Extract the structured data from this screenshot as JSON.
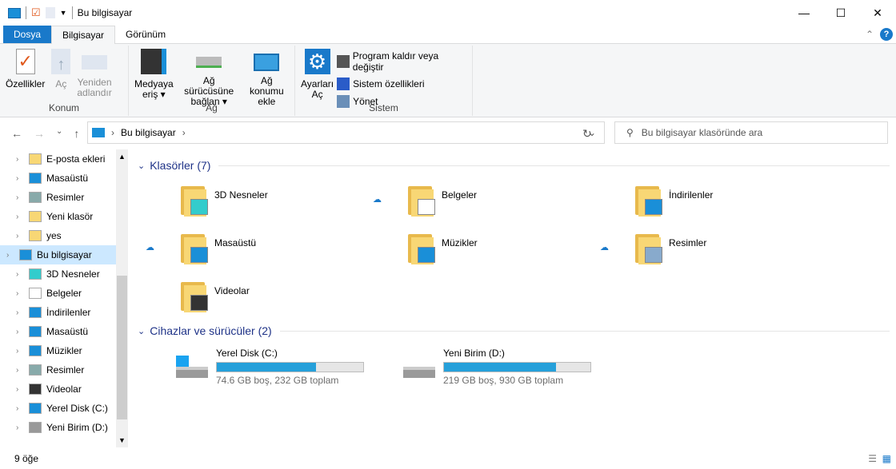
{
  "title": "Bu bilgisayar",
  "tabs": {
    "file": "Dosya",
    "computer": "Bilgisayar",
    "view": "Görünüm"
  },
  "ribbon": {
    "konum": {
      "label": "Konum",
      "properties": "Özellikler",
      "open": "Aç",
      "rename1": "Yeniden",
      "rename2": "adlandır"
    },
    "ag": {
      "label": "Ağ",
      "media1": "Medyaya",
      "media2": "eriş",
      "map1": "Ağ sürücüsüne",
      "map2": "bağlan",
      "addloc1": "Ağ konumu",
      "addloc2": "ekle"
    },
    "sistem": {
      "label": "Sistem",
      "settings1": "Ayarları",
      "settings2": "Aç",
      "uninstall": "Program kaldır veya değiştir",
      "sysprops": "Sistem özellikleri",
      "manage": "Yönet"
    }
  },
  "address": {
    "path": "Bu bilgisayar",
    "search_placeholder": "Bu bilgisayar klasöründe ara"
  },
  "sidebar": {
    "items": [
      "E-posta ekleri",
      "Masaüstü",
      "Resimler",
      "Yeni klasör",
      "yes",
      "Bu bilgisayar",
      "3D Nesneler",
      "Belgeler",
      "İndirilenler",
      "Masaüstü",
      "Müzikler",
      "Resimler",
      "Videolar",
      "Yerel Disk (C:)",
      "Yeni Birim (D:)"
    ]
  },
  "folders": {
    "header": "Klasörler (7)",
    "items": [
      "3D Nesneler",
      "Belgeler",
      "İndirilenler",
      "Masaüstü",
      "Müzikler",
      "Resimler",
      "Videolar"
    ]
  },
  "drives": {
    "header": "Cihazlar ve sürücüler (2)",
    "items": [
      {
        "name": "Yerel Disk (C:)",
        "info": "74.6 GB boş, 232 GB toplam",
        "used": 0.678
      },
      {
        "name": "Yeni Birim (D:)",
        "info": "219 GB boş, 930 GB toplam",
        "used": 0.765
      }
    ]
  },
  "status": "9 öğe"
}
